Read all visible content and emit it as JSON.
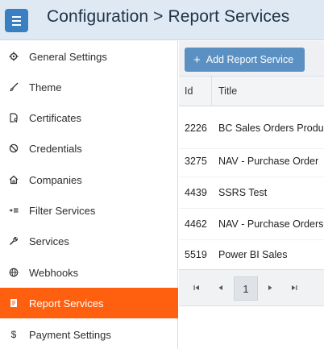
{
  "header": {
    "title": "Configuration > Report Services",
    "menu_icon": "hamburger-icon"
  },
  "sidebar": {
    "active_color": "#ff6010",
    "items": [
      {
        "label": "General Settings",
        "icon": "gear-icon"
      },
      {
        "label": "Theme",
        "icon": "brush-icon"
      },
      {
        "label": "Certificates",
        "icon": "certificate-icon"
      },
      {
        "label": "Credentials",
        "icon": "ban-icon"
      },
      {
        "label": "Companies",
        "icon": "home-icon"
      },
      {
        "label": "Filter Services",
        "icon": "filter-icon"
      },
      {
        "label": "Services",
        "icon": "wrench-icon"
      },
      {
        "label": "Webhooks",
        "icon": "globe-icon"
      },
      {
        "label": "Report Services",
        "icon": "report-icon",
        "active": true
      },
      {
        "label": "Payment Settings",
        "icon": "dollar-icon"
      }
    ]
  },
  "toolbar": {
    "add_label": "Add Report Service",
    "add_icon": "plus-icon"
  },
  "grid": {
    "columns": [
      "Id",
      "Title"
    ],
    "rows": [
      {
        "id": "2226",
        "title": "BC Sales Orders Produc"
      },
      {
        "id": "3275",
        "title": "NAV - Purchase Order"
      },
      {
        "id": "4439",
        "title": "SSRS Test"
      },
      {
        "id": "4462",
        "title": "NAV - Purchase Orders"
      },
      {
        "id": "5519",
        "title": "Power BI Sales"
      }
    ]
  },
  "pager": {
    "current_page": "1"
  }
}
